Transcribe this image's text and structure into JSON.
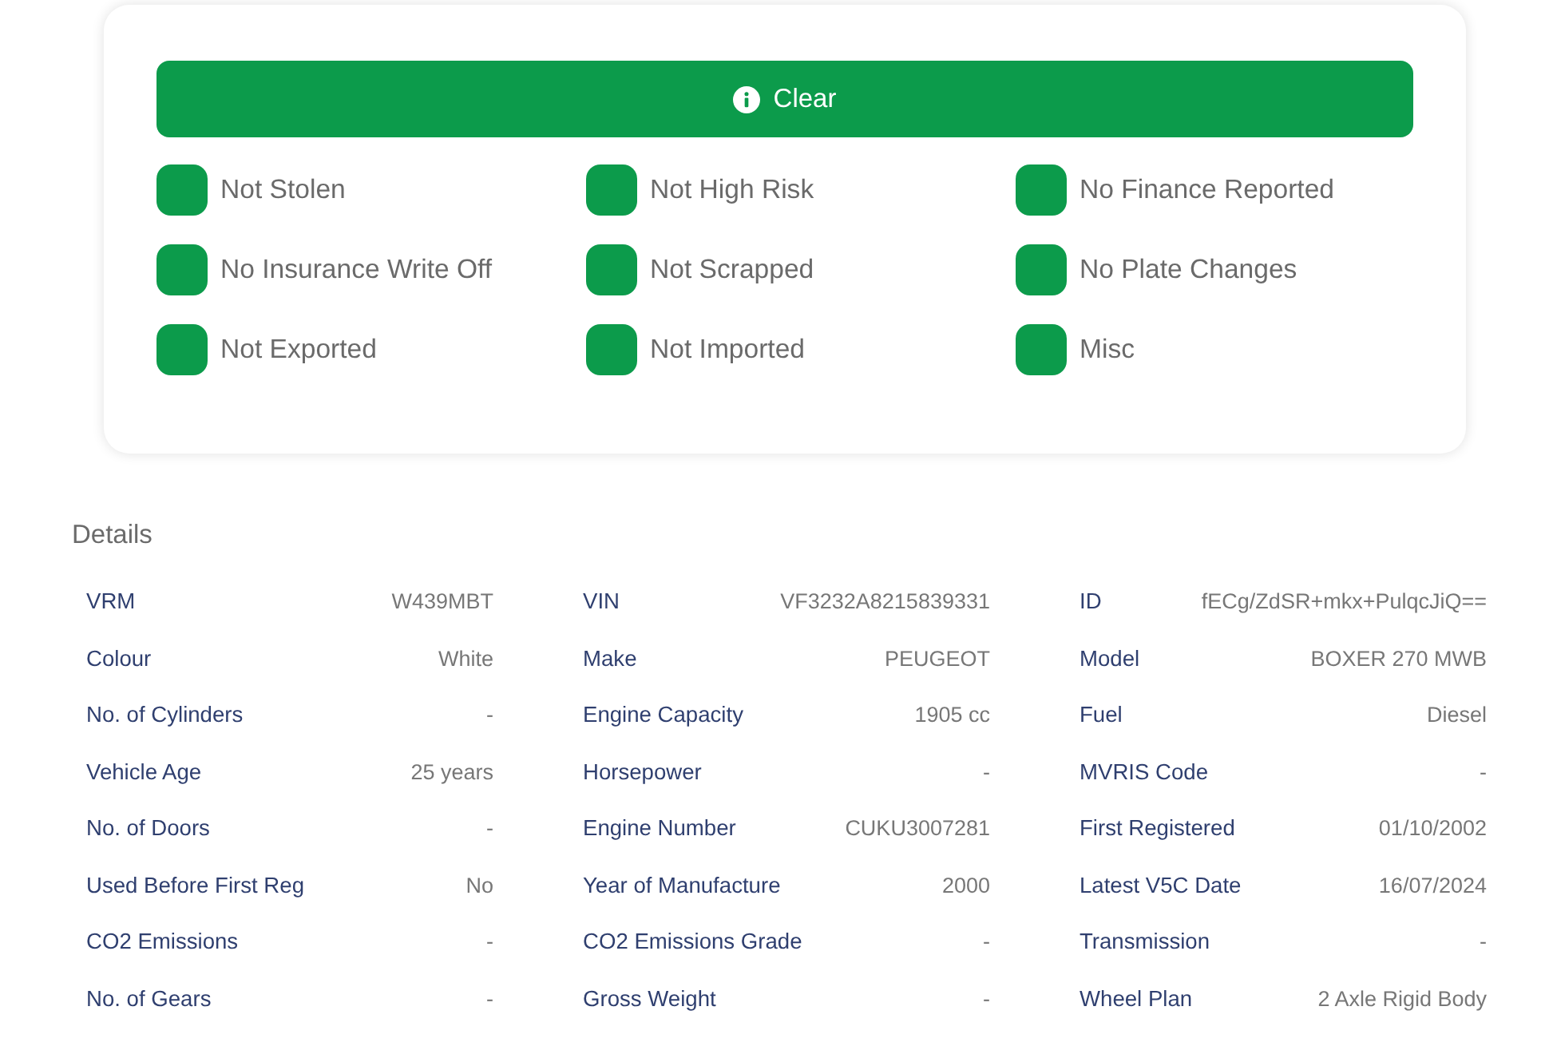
{
  "status_banner": {
    "kind": "clear",
    "label": "Clear"
  },
  "checks": [
    {
      "label": "Not Stolen",
      "passed": true
    },
    {
      "label": "Not High Risk",
      "passed": true
    },
    {
      "label": "No Finance Reported",
      "passed": true
    },
    {
      "label": "No Insurance Write Off",
      "passed": true
    },
    {
      "label": "Not Scrapped",
      "passed": true
    },
    {
      "label": "No Plate Changes",
      "passed": true
    },
    {
      "label": "Not Exported",
      "passed": true
    },
    {
      "label": "Not Imported",
      "passed": true
    },
    {
      "label": "Misc",
      "passed": true
    }
  ],
  "details": {
    "title": "Details",
    "fields": [
      {
        "label": "VRM",
        "value": "W439MBT"
      },
      {
        "label": "VIN",
        "value": "VF3232A8215839331"
      },
      {
        "label": "ID",
        "value": "fECg/ZdSR+mkx+PulqcJiQ=="
      },
      {
        "label": "Colour",
        "value": "White"
      },
      {
        "label": "Make",
        "value": "PEUGEOT"
      },
      {
        "label": "Model",
        "value": "BOXER 270 MWB"
      },
      {
        "label": "No. of Cylinders",
        "value": "-"
      },
      {
        "label": "Engine Capacity",
        "value": "1905 cc"
      },
      {
        "label": "Fuel",
        "value": "Diesel"
      },
      {
        "label": "Vehicle Age",
        "value": "25 years"
      },
      {
        "label": "Horsepower",
        "value": "-"
      },
      {
        "label": "MVRIS Code",
        "value": "-"
      },
      {
        "label": "No. of Doors",
        "value": "-"
      },
      {
        "label": "Engine Number",
        "value": "CUKU3007281"
      },
      {
        "label": "First Registered",
        "value": "01/10/2002"
      },
      {
        "label": "Used Before First Reg",
        "value": "No"
      },
      {
        "label": "Year of Manufacture",
        "value": "2000"
      },
      {
        "label": "Latest V5C Date",
        "value": "16/07/2024"
      },
      {
        "label": "CO2 Emissions",
        "value": "-"
      },
      {
        "label": "CO2 Emissions Grade",
        "value": "-"
      },
      {
        "label": "Transmission",
        "value": "-"
      },
      {
        "label": "No. of Gears",
        "value": "-"
      },
      {
        "label": "Gross Weight",
        "value": "-"
      },
      {
        "label": "Wheel Plan",
        "value": "2 Axle Rigid Body"
      }
    ]
  }
}
